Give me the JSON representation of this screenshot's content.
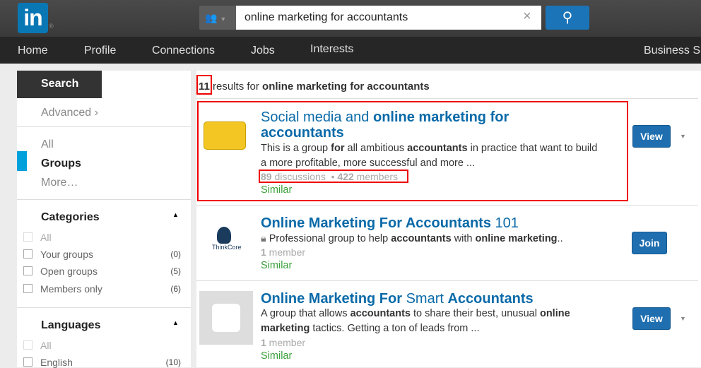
{
  "header": {
    "logo": "in",
    "search_value": "online marketing for accountants",
    "scope_icon": "groups-icon",
    "clear_icon": "×",
    "search_icon": "search-icon"
  },
  "nav": [
    "Home",
    "Profile",
    "Connections",
    "Jobs",
    "Interests",
    "Business S"
  ],
  "sidebar": {
    "search": "Search",
    "advanced": "Advanced",
    "types": [
      "All",
      "Groups",
      "More…"
    ],
    "categories": {
      "title": "Categories",
      "items": [
        {
          "label": "All",
          "count": ""
        },
        {
          "label": "Your groups",
          "count": "(0)"
        },
        {
          "label": "Open groups",
          "count": "(5)"
        },
        {
          "label": "Members only",
          "count": "(6)"
        }
      ]
    },
    "languages": {
      "title": "Languages",
      "items": [
        {
          "label": "All",
          "count": ""
        },
        {
          "label": "English",
          "count": "(10)"
        }
      ]
    }
  },
  "results_count": {
    "count": "11",
    "text": " results for ",
    "query": "online marketing for accountants"
  },
  "results": [
    {
      "title_a": "Social media and ",
      "title_b": "online marketing for accountants",
      "title_c": "",
      "desc": [
        "This is a group ",
        "for",
        " all ambitious ",
        "accountants",
        " in practice that want to build a more profitable, more successful and more ..."
      ],
      "discussions": "89",
      "discussions_label": " discussions",
      "members": "422",
      "members_label": " members",
      "similar": "Similar",
      "button": "View"
    },
    {
      "title_a": "",
      "title_b": "Online Marketing For Accountants",
      "title_c": " 101",
      "desc": [
        "Professional group to help ",
        "accountants",
        " with ",
        "online marketing",
        ".."
      ],
      "members": "1",
      "members_label": " member",
      "similar": "Similar",
      "button": "Join"
    },
    {
      "title_a": "",
      "title_b": "Online Marketing For",
      "title_c": " Smart ",
      "title_d": "Accountants",
      "desc": [
        "A group that allows ",
        "accountants",
        " to share their best, unusual ",
        "online marketing",
        " tactics. Getting a ton of leads from ..."
      ],
      "members": "1",
      "members_label": " member",
      "similar": "Similar",
      "button": "View"
    }
  ],
  "colors": {
    "brand": "#0a77b5",
    "link": "#0a6aa8",
    "highlight": "#e00000",
    "similar": "#3aa03a"
  }
}
